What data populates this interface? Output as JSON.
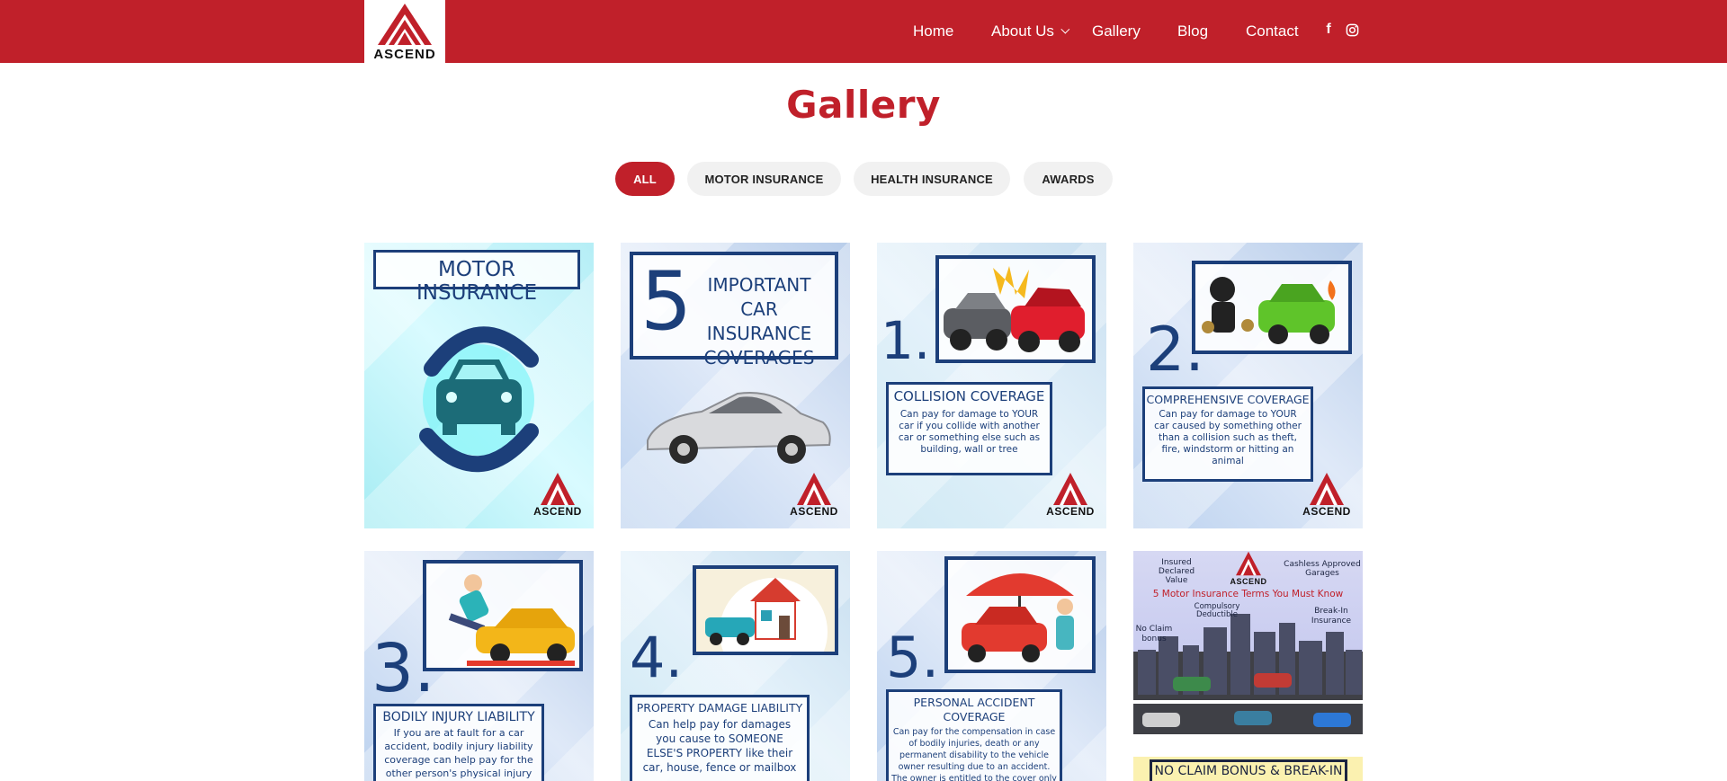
{
  "brand": {
    "logo_text": "ASCEND",
    "primary_color": "#c0202a",
    "ink_color": "#1c3f7a"
  },
  "nav": {
    "items": [
      {
        "label": "Home"
      },
      {
        "label": "About Us",
        "icon": "chevron-down-icon"
      },
      {
        "label": "Gallery"
      },
      {
        "label": "Blog"
      },
      {
        "label": "Contact"
      }
    ],
    "social": [
      {
        "icon": "facebook-icon",
        "glyph": "f"
      },
      {
        "icon": "instagram-icon"
      }
    ]
  },
  "page": {
    "title": "Gallery"
  },
  "filters": [
    {
      "label": "ALL",
      "active": true
    },
    {
      "label": "MOTOR INSURANCE",
      "active": false
    },
    {
      "label": "HEALTH INSURANCE",
      "active": false
    },
    {
      "label": "AWARDS",
      "active": false
    }
  ],
  "gallery": [
    {
      "heading": "MOTOR INSURANCE"
    },
    {
      "number": "5",
      "heading": "IMPORTANT CAR INSURANCE COVERAGES"
    },
    {
      "number": "1.",
      "heading": "COLLISION COVERAGE",
      "body": "Can pay for damage to YOUR car if you collide with another car or something else such as building, wall or tree"
    },
    {
      "number": "2.",
      "heading": "COMPREHENSIVE COVERAGE",
      "body": "Can pay for damage to YOUR car caused by something other than a collision such as theft, fire, windstorm or hitting an animal"
    },
    {
      "number": "3.",
      "heading": "BODILY INJURY LIABILITY",
      "body": "If you are at fault for a car accident, bodily injury liability coverage can help pay for the other person's physical injury and"
    },
    {
      "number": "4.",
      "heading": "PROPERTY DAMAGE LIABILITY",
      "body": "Can help pay for damages you cause to SOMEONE ELSE'S PROPERTY like their car, house, fence or mailbox"
    },
    {
      "number": "5.",
      "heading": "PERSONAL ACCIDENT COVERAGE",
      "body": "Can pay for the compensation in case of bodily injuries, death or any permanent disability to the vehicle owner resulting due to an accident. The owner is entitled to the cover only if they possess a valid"
    },
    {
      "title": "5 Motor Insurance Terms You Must Know",
      "terms": [
        "Insured Declared Value",
        "Cashless Approved Garages",
        "Compulsory Deductible",
        "Break-In Insurance",
        "No Claim bonus"
      ]
    },
    {
      "heading": "NO CLAIM BONUS & BREAK-IN"
    }
  ]
}
